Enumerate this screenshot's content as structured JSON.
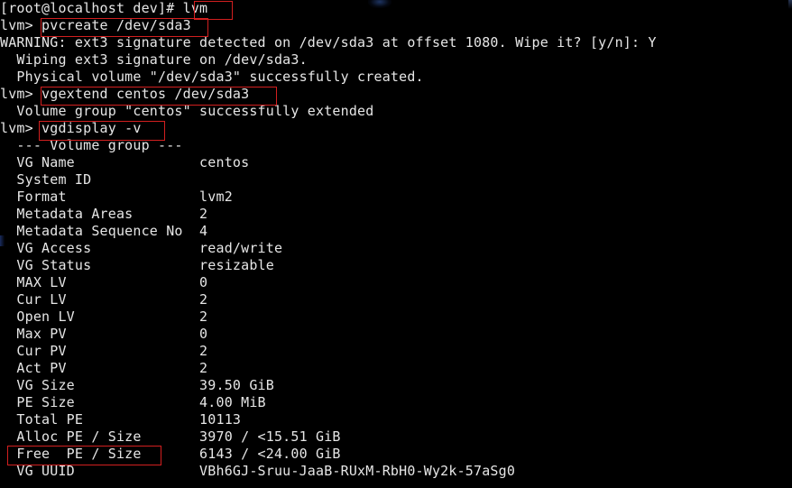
{
  "terminal": {
    "title": "root@localhost:/dev",
    "shell_prompt": "[root@localhost dev]#",
    "lvm_prompt": "lvm>",
    "background_color": "#000000",
    "text_color": "#e6e6e6",
    "highlight_color": "#d21f1f",
    "columns": 96,
    "rows": 28,
    "lines": [
      "[root@localhost dev]# lvm",
      "lvm> pvcreate /dev/sda3",
      "WARNING: ext3 signature detected on /dev/sda3 at offset 1080. Wipe it? [y/n]: Y",
      "  Wiping ext3 signature on /dev/sda3.",
      "  Physical volume \"/dev/sda3\" successfully created.",
      "lvm> vgextend centos /dev/sda3",
      "  Volume group \"centos\" successfully extended",
      "lvm> vgdisplay -v",
      "  --- Volume group ---",
      "  VG Name               centos",
      "  System ID",
      "  Format                lvm2",
      "  Metadata Areas        2",
      "  Metadata Sequence No  4",
      "  VG Access             read/write",
      "  VG Status             resizable",
      "  MAX LV                0",
      "  Cur LV                2",
      "  Open LV               2",
      "  Max PV                0",
      "  Cur PV                2",
      "  Act PV                2",
      "  VG Size               39.50 GiB",
      "  PE Size               4.00 MiB",
      "  Total PE              10113",
      "  Alloc PE / Size       3970 / <15.51 GiB",
      "  Free  PE / Size       6143 / <24.00 GiB",
      "  VG UUID               VBh6GJ-Sruu-JaaB-RUxM-RbH0-Wy2k-57aSg0"
    ],
    "commands": [
      {
        "name": "lvm",
        "text": "lvm"
      },
      {
        "name": "pvcreate",
        "text": "pvcreate /dev/sda3"
      },
      {
        "name": "vgextend",
        "text": "vgextend centos /dev/sda3"
      },
      {
        "name": "vgdisplay",
        "text": "vgdisplay -v"
      }
    ],
    "messages": [
      "WARNING: ext3 signature detected on /dev/sda3 at offset 1080. Wipe it? [y/n]: Y",
      "  Wiping ext3 signature on /dev/sda3.",
      "  Physical volume \"/dev/sda3\" successfully created.",
      "  Volume group \"centos\" successfully extended"
    ],
    "answer_prompt": "[y/n]:",
    "answer_value": "Y",
    "vgdisplay": {
      "section_header": "--- Volume group ---",
      "fields": [
        {
          "label": "VG Name",
          "value": "centos"
        },
        {
          "label": "System ID",
          "value": ""
        },
        {
          "label": "Format",
          "value": "lvm2"
        },
        {
          "label": "Metadata Areas",
          "value": "2"
        },
        {
          "label": "Metadata Sequence No",
          "value": "4"
        },
        {
          "label": "VG Access",
          "value": "read/write"
        },
        {
          "label": "VG Status",
          "value": "resizable"
        },
        {
          "label": "MAX LV",
          "value": "0"
        },
        {
          "label": "Cur LV",
          "value": "2"
        },
        {
          "label": "Open LV",
          "value": "2"
        },
        {
          "label": "Max PV",
          "value": "0"
        },
        {
          "label": "Cur PV",
          "value": "2"
        },
        {
          "label": "Act PV",
          "value": "2"
        },
        {
          "label": "VG Size",
          "value": "39.50 GiB"
        },
        {
          "label": "PE Size",
          "value": "4.00 MiB"
        },
        {
          "label": "Total PE",
          "value": "10113"
        },
        {
          "label": "Alloc PE / Size",
          "value": "3970 / <15.51 GiB"
        },
        {
          "label": "Free  PE / Size",
          "value": "6143 / <24.00 GiB"
        },
        {
          "label": "VG UUID",
          "value": "VBh6GJ-Sruu-JaaB-RUxM-RbH0-Wy2k-57aSg0"
        }
      ]
    },
    "highlights": [
      {
        "name": "lvm-command",
        "label": "lvm"
      },
      {
        "name": "pvcreate-command",
        "label": "pvcreate /dev/sda3"
      },
      {
        "name": "vgextend-command",
        "label": "vgextend centos /dev/sda3"
      },
      {
        "name": "vgdisplay-command",
        "label": "vgdisplay -v"
      },
      {
        "name": "free-pe-size-row",
        "label": "Free  PE / Size"
      }
    ]
  }
}
